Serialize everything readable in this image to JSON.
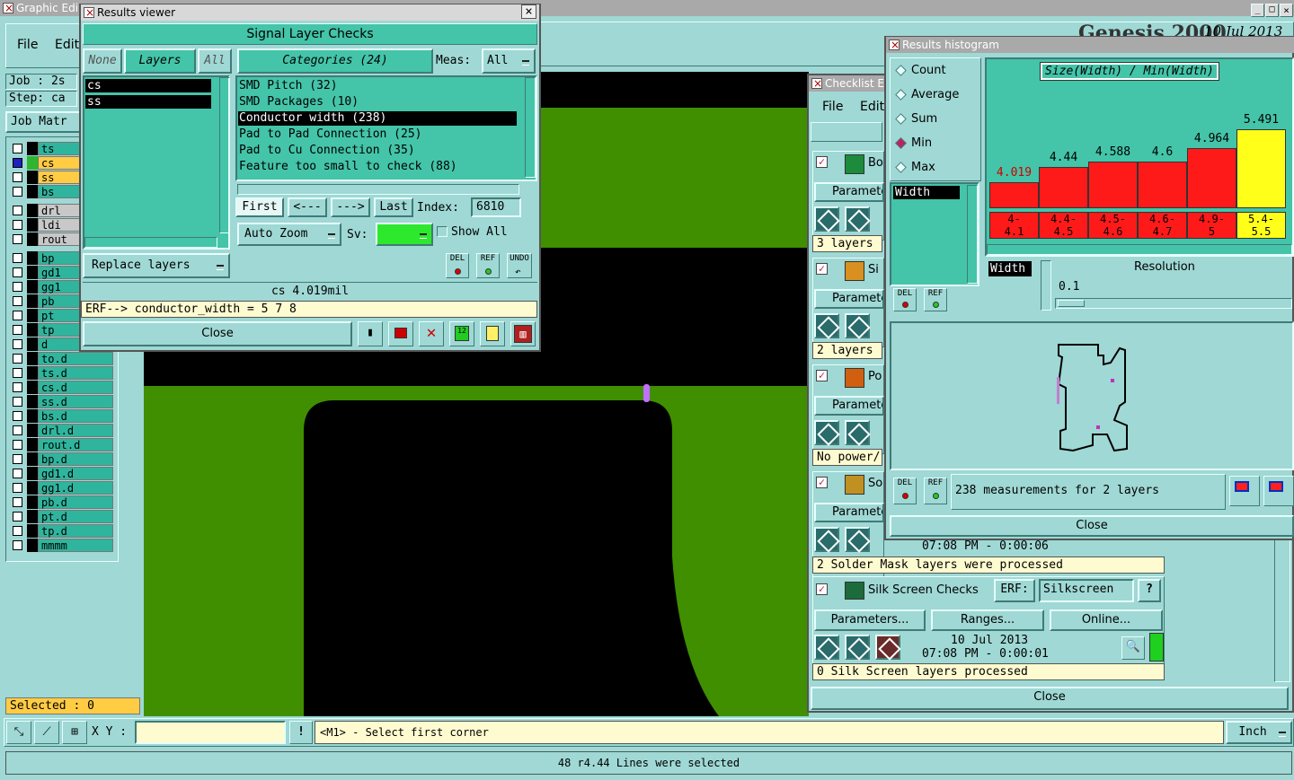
{
  "graphic_editor": {
    "title": "Graphic Edi",
    "menu": [
      "File",
      "Edit"
    ],
    "job_label": "Job : 2s",
    "step_label": "Step: ca",
    "job_matrix": "Job Matr",
    "layers": [
      {
        "name": "ts",
        "color": "#2fb59d"
      },
      {
        "name": "cs",
        "color": "#ffcc44"
      },
      {
        "name": "ss",
        "color": "#ffcc44"
      },
      {
        "name": "bs",
        "color": "#2fb59d"
      },
      {
        "name": "drl",
        "color": "#c8c8c8"
      },
      {
        "name": "ldi",
        "color": "#c8c8c8"
      },
      {
        "name": "rout",
        "color": "#c8c8c8"
      },
      {
        "name": "bp",
        "color": "#2fb59d"
      },
      {
        "name": "gd1",
        "color": "#2fb59d"
      },
      {
        "name": "gg1",
        "color": "#2fb59d"
      },
      {
        "name": "pb",
        "color": "#2fb59d"
      },
      {
        "name": "pt",
        "color": "#2fb59d"
      },
      {
        "name": "tp",
        "color": "#2fb59d"
      },
      {
        "name": "d",
        "color": "#2fb59d"
      },
      {
        "name": "to.d",
        "color": "#2fb59d"
      },
      {
        "name": "ts.d",
        "color": "#2fb59d"
      },
      {
        "name": "cs.d",
        "color": "#2fb59d"
      },
      {
        "name": "ss.d",
        "color": "#2fb59d"
      },
      {
        "name": "bs.d",
        "color": "#2fb59d"
      },
      {
        "name": "drl.d",
        "color": "#2fb59d"
      },
      {
        "name": "rout.d",
        "color": "#2fb59d"
      },
      {
        "name": "bp.d",
        "color": "#2fb59d"
      },
      {
        "name": "gd1.d",
        "color": "#2fb59d"
      },
      {
        "name": "gg1.d",
        "color": "#2fb59d"
      },
      {
        "name": "pb.d",
        "color": "#2fb59d"
      },
      {
        "name": "pt.d",
        "color": "#2fb59d"
      },
      {
        "name": "tp.d",
        "color": "#2fb59d"
      },
      {
        "name": "mmmm",
        "color": "#2fb59d"
      }
    ],
    "selected": "Selected : 0",
    "xy_label": "X Y :",
    "xy_value": "",
    "prompt": "<M1> - Select first corner",
    "units": "Inch",
    "status": "48 r4.44 Lines were selected",
    "banner": "Genesis 2000",
    "banner_date": "10 Jul 2013"
  },
  "results_viewer": {
    "title": "Results viewer",
    "header": "Signal Layer Checks",
    "none_btn": "None",
    "layers_btn": "Layers",
    "all_btn": "All",
    "categories_label": "Categories (24)",
    "meas_label": "Meas:",
    "meas_value": "All",
    "layer_list": [
      "cs",
      "ss"
    ],
    "categories": [
      {
        "label": "SMD Pitch (32)",
        "selected": false
      },
      {
        "label": "SMD Packages (10)",
        "selected": false
      },
      {
        "label": "Conductor width (238)",
        "selected": true
      },
      {
        "label": "Pad to Pad Connection (25)",
        "selected": false
      },
      {
        "label": "Pad to Cu Connection (35)",
        "selected": false
      },
      {
        "label": "Feature too small to check (88)",
        "selected": false
      }
    ],
    "first": "First",
    "prev": "<---",
    "next": "--->",
    "last": "Last",
    "index_label": "Index:",
    "index_value": "6810",
    "auto_zoom": "Auto Zoom",
    "sv_label": "Sv:",
    "show_all": "Show All",
    "replace_layers": "Replace layers",
    "del": "DEL",
    "ref": "REF",
    "undo": "UNDO",
    "measurement": "cs 4.019mil",
    "erf_line": "ERF--> conductor_width = 5 7 8",
    "close": "Close"
  },
  "results_histogram": {
    "title": "Results histogram",
    "modes": [
      {
        "label": "Count",
        "selected": false
      },
      {
        "label": "Average",
        "selected": false
      },
      {
        "label": "Sum",
        "selected": false
      },
      {
        "label": "Min",
        "selected": true
      },
      {
        "label": "Max",
        "selected": false
      }
    ],
    "measure_list": [
      "Width"
    ],
    "chart_title": "Size(Width) / Min(Width)",
    "width_label": "Width",
    "resolution_label": "Resolution",
    "resolution_value": "0.1",
    "del": "DEL",
    "ref": "REF",
    "summary": "238 measurements for 2 layers",
    "close": "Close"
  },
  "chart_data": {
    "type": "bar",
    "title": "Size(Width) / Min(Width)",
    "categories": [
      "4-\n4.1",
      "4.4-\n4.5",
      "4.5-\n4.6",
      "4.6-\n4.7",
      "4.9-\n5",
      "5.4-\n5.5"
    ],
    "values": [
      4.019,
      4.44,
      4.588,
      4.6,
      4.964,
      5.491
    ],
    "value_labels": [
      "4.019",
      "4.44",
      "4.588",
      "4.6",
      "4.964",
      "5.491"
    ],
    "highlight_index": 5,
    "colors": {
      "normal": "#ff1a1a",
      "highlight": "#ffff1a"
    },
    "ylim": [
      3.3,
      5.5
    ]
  },
  "checklist": {
    "title": "Checklist E",
    "menu": [
      "File",
      "Edit"
    ],
    "rows": [
      {
        "name": "Bo",
        "params": "Paramete",
        "info": "3 layers"
      },
      {
        "name": "Si",
        "params": "Paramete",
        "info": "2 layers"
      },
      {
        "name": "Po",
        "params": "Paramete",
        "info": "No power/"
      },
      {
        "name": "So",
        "params": "Paramete",
        "info": ""
      }
    ],
    "solder_time": "07:08 PM - 0:00:06",
    "solder_info": "2 Solder Mask layers were processed",
    "silk_name": "Silk Screen Checks",
    "erf_label": "ERF:",
    "erf_value": "Silkscreen",
    "help": "?",
    "parameters": "Parameters...",
    "ranges": "Ranges...",
    "online": "Online...",
    "silk_date": "10 Jul 2013",
    "silk_time": "07:08 PM - 0:00:01",
    "silk_info": "0 Silk Screen layers processed",
    "close": "Close"
  }
}
